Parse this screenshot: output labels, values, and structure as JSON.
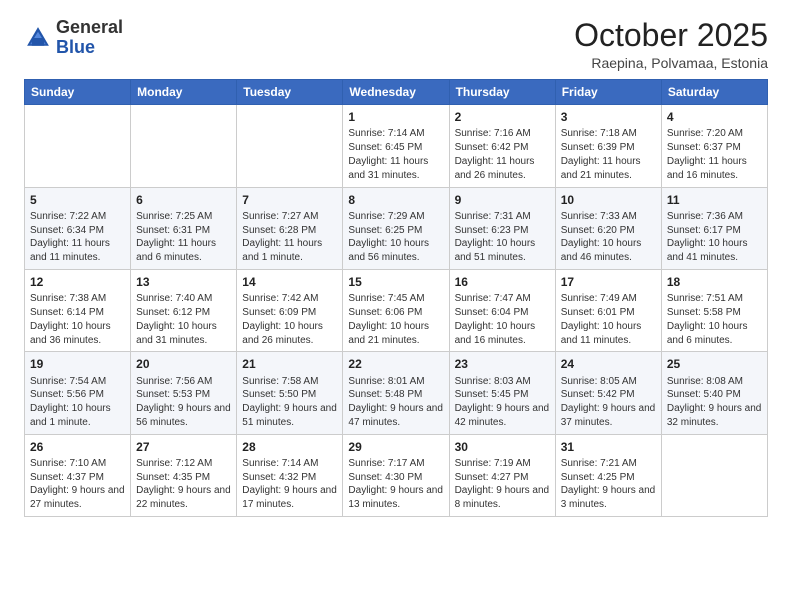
{
  "logo": {
    "text_general": "General",
    "text_blue": "Blue"
  },
  "header": {
    "month": "October 2025",
    "location": "Raepina, Polvamaa, Estonia"
  },
  "weekdays": [
    "Sunday",
    "Monday",
    "Tuesday",
    "Wednesday",
    "Thursday",
    "Friday",
    "Saturday"
  ],
  "weeks": [
    [
      {
        "day": "",
        "content": ""
      },
      {
        "day": "",
        "content": ""
      },
      {
        "day": "",
        "content": ""
      },
      {
        "day": "1",
        "content": "Sunrise: 7:14 AM\nSunset: 6:45 PM\nDaylight: 11 hours and 31 minutes."
      },
      {
        "day": "2",
        "content": "Sunrise: 7:16 AM\nSunset: 6:42 PM\nDaylight: 11 hours and 26 minutes."
      },
      {
        "day": "3",
        "content": "Sunrise: 7:18 AM\nSunset: 6:39 PM\nDaylight: 11 hours and 21 minutes."
      },
      {
        "day": "4",
        "content": "Sunrise: 7:20 AM\nSunset: 6:37 PM\nDaylight: 11 hours and 16 minutes."
      }
    ],
    [
      {
        "day": "5",
        "content": "Sunrise: 7:22 AM\nSunset: 6:34 PM\nDaylight: 11 hours and 11 minutes."
      },
      {
        "day": "6",
        "content": "Sunrise: 7:25 AM\nSunset: 6:31 PM\nDaylight: 11 hours and 6 minutes."
      },
      {
        "day": "7",
        "content": "Sunrise: 7:27 AM\nSunset: 6:28 PM\nDaylight: 11 hours and 1 minute."
      },
      {
        "day": "8",
        "content": "Sunrise: 7:29 AM\nSunset: 6:25 PM\nDaylight: 10 hours and 56 minutes."
      },
      {
        "day": "9",
        "content": "Sunrise: 7:31 AM\nSunset: 6:23 PM\nDaylight: 10 hours and 51 minutes."
      },
      {
        "day": "10",
        "content": "Sunrise: 7:33 AM\nSunset: 6:20 PM\nDaylight: 10 hours and 46 minutes."
      },
      {
        "day": "11",
        "content": "Sunrise: 7:36 AM\nSunset: 6:17 PM\nDaylight: 10 hours and 41 minutes."
      }
    ],
    [
      {
        "day": "12",
        "content": "Sunrise: 7:38 AM\nSunset: 6:14 PM\nDaylight: 10 hours and 36 minutes."
      },
      {
        "day": "13",
        "content": "Sunrise: 7:40 AM\nSunset: 6:12 PM\nDaylight: 10 hours and 31 minutes."
      },
      {
        "day": "14",
        "content": "Sunrise: 7:42 AM\nSunset: 6:09 PM\nDaylight: 10 hours and 26 minutes."
      },
      {
        "day": "15",
        "content": "Sunrise: 7:45 AM\nSunset: 6:06 PM\nDaylight: 10 hours and 21 minutes."
      },
      {
        "day": "16",
        "content": "Sunrise: 7:47 AM\nSunset: 6:04 PM\nDaylight: 10 hours and 16 minutes."
      },
      {
        "day": "17",
        "content": "Sunrise: 7:49 AM\nSunset: 6:01 PM\nDaylight: 10 hours and 11 minutes."
      },
      {
        "day": "18",
        "content": "Sunrise: 7:51 AM\nSunset: 5:58 PM\nDaylight: 10 hours and 6 minutes."
      }
    ],
    [
      {
        "day": "19",
        "content": "Sunrise: 7:54 AM\nSunset: 5:56 PM\nDaylight: 10 hours and 1 minute."
      },
      {
        "day": "20",
        "content": "Sunrise: 7:56 AM\nSunset: 5:53 PM\nDaylight: 9 hours and 56 minutes."
      },
      {
        "day": "21",
        "content": "Sunrise: 7:58 AM\nSunset: 5:50 PM\nDaylight: 9 hours and 51 minutes."
      },
      {
        "day": "22",
        "content": "Sunrise: 8:01 AM\nSunset: 5:48 PM\nDaylight: 9 hours and 47 minutes."
      },
      {
        "day": "23",
        "content": "Sunrise: 8:03 AM\nSunset: 5:45 PM\nDaylight: 9 hours and 42 minutes."
      },
      {
        "day": "24",
        "content": "Sunrise: 8:05 AM\nSunset: 5:42 PM\nDaylight: 9 hours and 37 minutes."
      },
      {
        "day": "25",
        "content": "Sunrise: 8:08 AM\nSunset: 5:40 PM\nDaylight: 9 hours and 32 minutes."
      }
    ],
    [
      {
        "day": "26",
        "content": "Sunrise: 7:10 AM\nSunset: 4:37 PM\nDaylight: 9 hours and 27 minutes."
      },
      {
        "day": "27",
        "content": "Sunrise: 7:12 AM\nSunset: 4:35 PM\nDaylight: 9 hours and 22 minutes."
      },
      {
        "day": "28",
        "content": "Sunrise: 7:14 AM\nSunset: 4:32 PM\nDaylight: 9 hours and 17 minutes."
      },
      {
        "day": "29",
        "content": "Sunrise: 7:17 AM\nSunset: 4:30 PM\nDaylight: 9 hours and 13 minutes."
      },
      {
        "day": "30",
        "content": "Sunrise: 7:19 AM\nSunset: 4:27 PM\nDaylight: 9 hours and 8 minutes."
      },
      {
        "day": "31",
        "content": "Sunrise: 7:21 AM\nSunset: 4:25 PM\nDaylight: 9 hours and 3 minutes."
      },
      {
        "day": "",
        "content": ""
      }
    ]
  ]
}
